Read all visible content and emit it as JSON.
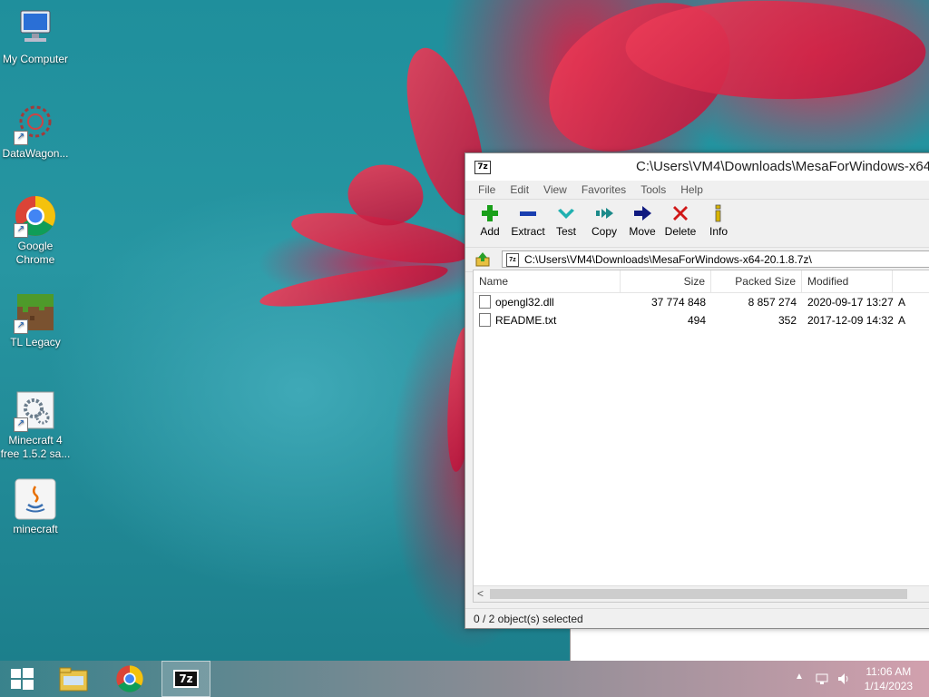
{
  "desktop": {
    "icons": [
      {
        "label": "My Computer"
      },
      {
        "label": "DataWagon..."
      },
      {
        "label": "Google Chrome"
      },
      {
        "label": "TL Legacy"
      },
      {
        "label": "Minecraft 4 free 1.5.2 sa..."
      },
      {
        "label": "minecraft"
      }
    ]
  },
  "window": {
    "title": "C:\\Users\\VM4\\Downloads\\MesaForWindows-x64",
    "app_icon_text": "7z",
    "menu": [
      "File",
      "Edit",
      "View",
      "Favorites",
      "Tools",
      "Help"
    ],
    "toolbar": [
      {
        "label": "Add",
        "icon": "plus-icon",
        "color": "#1aa01a"
      },
      {
        "label": "Extract",
        "icon": "minus-icon",
        "color": "#1a3fb0"
      },
      {
        "label": "Test",
        "icon": "check-icon",
        "color": "#20b0b0"
      },
      {
        "label": "Copy",
        "icon": "double-arrow-icon",
        "color": "#1c8a8a"
      },
      {
        "label": "Move",
        "icon": "arrow-right-icon",
        "color": "#101a80"
      },
      {
        "label": "Delete",
        "icon": "x-icon",
        "color": "#d01818"
      },
      {
        "label": "Info",
        "icon": "info-icon",
        "color": "#d8b400"
      }
    ],
    "address": "C:\\Users\\VM4\\Downloads\\MesaForWindows-x64-20.1.8.7z\\",
    "columns": [
      "Name",
      "Size",
      "Packed Size",
      "Modified"
    ],
    "files": [
      {
        "name": "opengl32.dll",
        "size": "37 774 848",
        "packed": "8 857 274",
        "modified": "2020-09-17 13:27",
        "attr": "A"
      },
      {
        "name": "README.txt",
        "size": "494",
        "packed": "352",
        "modified": "2017-12-09 14:32",
        "attr": "A"
      }
    ],
    "status": "0 / 2 object(s) selected"
  },
  "taskbar": {
    "time": "11:06 AM",
    "date": "1/14/2023",
    "app_7zip_text": "7z"
  }
}
